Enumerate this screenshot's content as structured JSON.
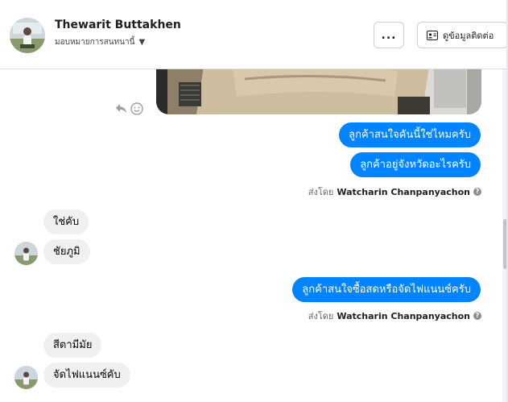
{
  "header": {
    "contact_name": "Thewarit Buttakhen",
    "assign_label": "มอบหมายการสนทนานี้",
    "more_label": "...",
    "contact_info_label": "ดูข้อมูลติดต่อ"
  },
  "thread": {
    "outgoing_group_1": [
      "ลูกค้าสนใจคันนี้ใช่ไหมครับ",
      "ลูกค้าอยู่จังหวัดอะไรครับ"
    ],
    "sent_by_1": {
      "prefix": "ส่งโดย",
      "agent": "Watcharin Chanpanyachon"
    },
    "incoming_group_1": [
      "ใช่คับ",
      "ชัยภูมิ"
    ],
    "outgoing_group_2": [
      "ลูกค้าสนใจซื้อสดหรือจัดไฟแนนซ์ครับ"
    ],
    "sent_by_2": {
      "prefix": "ส่งโดย",
      "agent": "Watcharin Chanpanyachon"
    },
    "incoming_group_2": [
      "สีตามีมัย",
      "จัดไฟแนนซ์คับ"
    ]
  },
  "colors": {
    "outgoing_bubble": "#0084ff",
    "incoming_bubble": "#f0f0f0",
    "meta_text": "#65676b"
  },
  "icons": [
    "avatar",
    "chevron-down-icon",
    "more-icon",
    "contact-card-icon",
    "reply-icon",
    "smiley-icon",
    "help-icon"
  ]
}
